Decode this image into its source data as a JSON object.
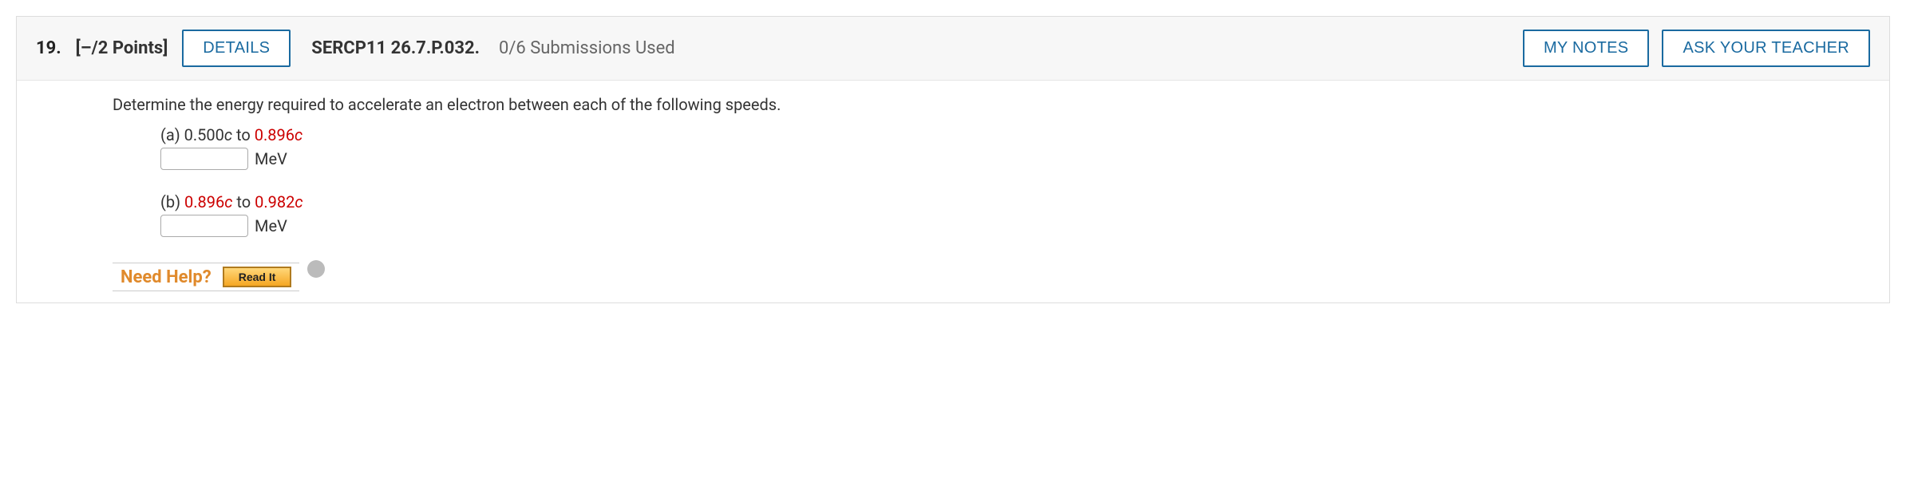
{
  "header": {
    "number": "19.",
    "points": "[–/2 Points]",
    "details_button": "DETAILS",
    "problem_code": "SERCP11 26.7.P.032.",
    "submissions": "0/6 Submissions Used",
    "my_notes_button": "MY NOTES",
    "ask_teacher_button": "ASK YOUR TEACHER"
  },
  "question": {
    "prompt": "Determine the energy required to accelerate an electron between each of the following speeds.",
    "parts": {
      "a": {
        "label": "(a) ",
        "from_plain": "0.500",
        "from_red": "",
        "to_word": " to ",
        "to_red": "0.896",
        "unit": "MeV"
      },
      "b": {
        "label": "(b) ",
        "from_plain": "",
        "from_red": "0.896",
        "to_word": " to ",
        "to_red": "0.982",
        "unit": "MeV"
      }
    }
  },
  "help": {
    "label": "Need Help?",
    "read_it": "Read It"
  }
}
